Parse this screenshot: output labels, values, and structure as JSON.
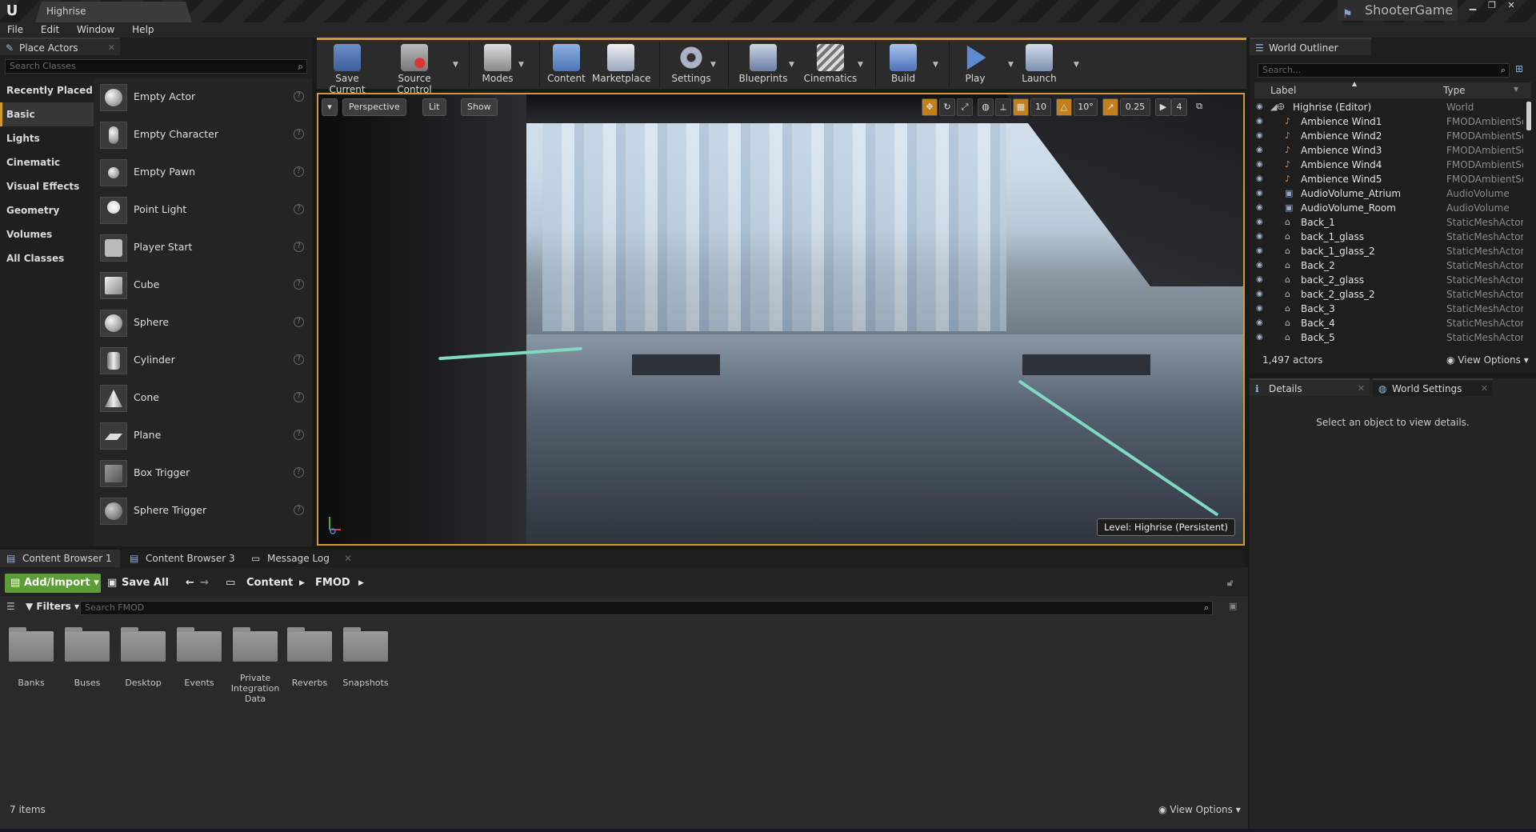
{
  "titlebar": {
    "doc_tab": "Highrise",
    "project": "ShooterGame"
  },
  "menu": [
    "File",
    "Edit",
    "Window",
    "Help"
  ],
  "place_actors": {
    "tab": "Place Actors",
    "search_placeholder": "Search Classes",
    "categories": [
      "Recently Placed",
      "Basic",
      "Lights",
      "Cinematic",
      "Visual Effects",
      "Geometry",
      "Volumes",
      "All Classes"
    ],
    "active_category": "Basic",
    "actors": [
      "Empty Actor",
      "Empty Character",
      "Empty Pawn",
      "Point Light",
      "Player Start",
      "Cube",
      "Sphere",
      "Cylinder",
      "Cone",
      "Plane",
      "Box Trigger",
      "Sphere Trigger"
    ]
  },
  "toolbar": {
    "save_current": "Save Current",
    "source_control": "Source Control",
    "modes": "Modes",
    "content": "Content",
    "marketplace": "Marketplace",
    "settings": "Settings",
    "blueprints": "Blueprints",
    "cinematics": "Cinematics",
    "build": "Build",
    "play": "Play",
    "launch": "Launch"
  },
  "viewport": {
    "perspective": "Perspective",
    "lit": "Lit",
    "show": "Show",
    "grid_snap": "10",
    "rotation_snap": "10°",
    "scale_snap": "0.25",
    "camera_speed": "4",
    "level": "Level:  Highrise (Persistent)"
  },
  "content_browser": {
    "tabs": [
      "Content Browser 1",
      "Content Browser 3",
      "Message Log"
    ],
    "add_import": "Add/Import",
    "save_all": "Save All",
    "path": [
      "Content",
      "FMOD"
    ],
    "filters": "Filters",
    "search_placeholder": "Search FMOD",
    "folders": [
      "Banks",
      "Buses",
      "Desktop",
      "Events",
      "Private Integration Data",
      "Reverbs",
      "Snapshots"
    ],
    "items_count": "7 items",
    "view_options": "View Options"
  },
  "outliner": {
    "tab": "World Outliner",
    "search_placeholder": "Search...",
    "col_label": "Label",
    "col_type": "Type",
    "rows": [
      {
        "label": "Highrise (Editor)",
        "type": "World"
      },
      {
        "label": "Ambience Wind1",
        "type": "FMODAmbientSound"
      },
      {
        "label": "Ambience Wind2",
        "type": "FMODAmbientSound"
      },
      {
        "label": "Ambience Wind3",
        "type": "FMODAmbientSound"
      },
      {
        "label": "Ambience Wind4",
        "type": "FMODAmbientSound"
      },
      {
        "label": "Ambience Wind5",
        "type": "FMODAmbientSound"
      },
      {
        "label": "AudioVolume_Atrium",
        "type": "AudioVolume"
      },
      {
        "label": "AudioVolume_Room",
        "type": "AudioVolume"
      },
      {
        "label": "Back_1",
        "type": "StaticMeshActor"
      },
      {
        "label": "back_1_glass",
        "type": "StaticMeshActor"
      },
      {
        "label": "back_1_glass_2",
        "type": "StaticMeshActor"
      },
      {
        "label": "Back_2",
        "type": "StaticMeshActor"
      },
      {
        "label": "back_2_glass",
        "type": "StaticMeshActor"
      },
      {
        "label": "back_2_glass_2",
        "type": "StaticMeshActor"
      },
      {
        "label": "Back_3",
        "type": "StaticMeshActor"
      },
      {
        "label": "Back_4",
        "type": "StaticMeshActor"
      },
      {
        "label": "Back_5",
        "type": "StaticMeshActor"
      }
    ],
    "actors_count": "1,497 actors",
    "view_options": "View Options"
  },
  "details": {
    "tab_details": "Details",
    "tab_world_settings": "World Settings",
    "empty_message": "Select an object to view details."
  }
}
